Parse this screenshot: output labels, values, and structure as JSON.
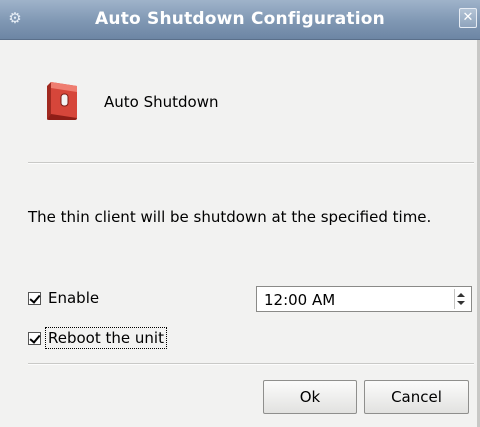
{
  "window": {
    "title": "Auto Shutdown Configuration",
    "icon": "gear-icon",
    "close_icon": "close-icon"
  },
  "header": {
    "icon": "power-switch-icon",
    "label": "Auto Shutdown"
  },
  "description": "The thin client will be shutdown at the specified time.",
  "options": {
    "enable": {
      "label": "Enable",
      "checked": true
    },
    "reboot": {
      "label": "Reboot the unit",
      "checked": true
    }
  },
  "time": {
    "value": "12:00 AM"
  },
  "buttons": {
    "ok": "Ok",
    "cancel": "Cancel"
  },
  "colors": {
    "titlebar": "#7f97b3",
    "switch_red": "#c8372d"
  }
}
